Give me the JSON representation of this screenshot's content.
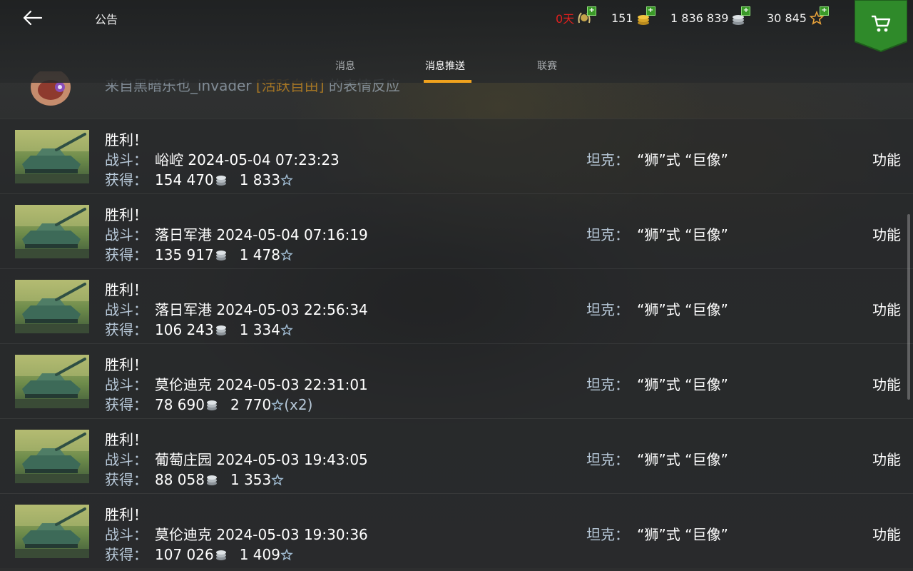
{
  "header": {
    "title": "公告",
    "resources": {
      "premium_days": "0天",
      "gold": "151",
      "credits": "1 836 839",
      "free_xp": "30 845"
    }
  },
  "tabs": [
    {
      "label": "消息",
      "active": false
    },
    {
      "label": "消息推送",
      "active": true
    },
    {
      "label": "联赛",
      "active": false
    }
  ],
  "partial_row": {
    "prefix": "来自黑暗乐也_invader",
    "highlight": "[活跃自由]",
    "suffix": "的表情反应"
  },
  "labels": {
    "battle": "战斗：",
    "earned": "获得：",
    "tank": "坦克：",
    "function": "功能"
  },
  "rows": [
    {
      "result": "胜利！",
      "battle": "峪崆 2024-05-04 07:23:23",
      "credits": "154 470",
      "xp": "1 833",
      "mult": "",
      "tank": "“狮”式 “巨像”"
    },
    {
      "result": "胜利！",
      "battle": "落日军港 2024-05-04 07:16:19",
      "credits": "135 917",
      "xp": "1 478",
      "mult": "",
      "tank": "“狮”式 “巨像”"
    },
    {
      "result": "胜利！",
      "battle": "落日军港 2024-05-03 22:56:34",
      "credits": "106 243",
      "xp": "1 334",
      "mult": "",
      "tank": "“狮”式 “巨像”"
    },
    {
      "result": "胜利！",
      "battle": "莫伦迪克 2024-05-03 22:31:01",
      "credits": "78 690",
      "xp": "2 770",
      "mult": "(x2)",
      "tank": "“狮”式 “巨像”"
    },
    {
      "result": "胜利！",
      "battle": "葡萄庄园 2024-05-03 19:43:05",
      "credits": "88 058",
      "xp": "1 353",
      "mult": "",
      "tank": "“狮”式 “巨像”"
    },
    {
      "result": "胜利！",
      "battle": "莫伦迪克 2024-05-03 19:30:36",
      "credits": "107 026",
      "xp": "1 409",
      "mult": "",
      "tank": "“狮”式 “巨像”"
    }
  ],
  "colors": {
    "accent": "#f0a21d",
    "premium_red": "#e0201e",
    "label_blue": "#b7c8d8",
    "shop_green": "#2f8a2a"
  }
}
